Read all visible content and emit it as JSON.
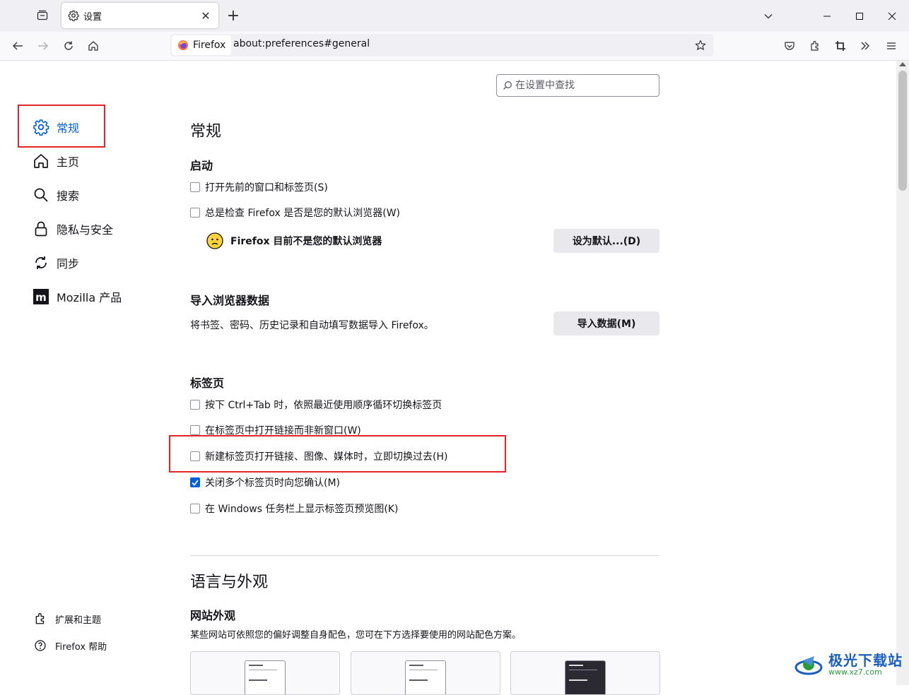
{
  "browser": {
    "tab_title": "设置",
    "url_identity": "Firefox",
    "url": "about:preferences#general"
  },
  "search": {
    "placeholder": "在设置中查找"
  },
  "sidebar": {
    "items": [
      {
        "label": "常规",
        "icon": "gear-icon"
      },
      {
        "label": "主页",
        "icon": "home-icon"
      },
      {
        "label": "搜索",
        "icon": "search-icon"
      },
      {
        "label": "隐私与安全",
        "icon": "lock-icon"
      },
      {
        "label": "同步",
        "icon": "sync-icon"
      },
      {
        "label": "Mozilla 产品",
        "icon": "mozilla-icon"
      }
    ],
    "footer": [
      {
        "label": "扩展和主题",
        "icon": "puzzle-icon"
      },
      {
        "label": "Firefox 帮助",
        "icon": "help-icon"
      }
    ]
  },
  "main": {
    "title": "常规",
    "startup": {
      "heading": "启动",
      "options": [
        {
          "label": "打开先前的窗口和标签页(S)",
          "checked": false
        },
        {
          "label": "总是检查 Firefox 是否是您的默认浏览器(W)",
          "checked": false
        }
      ],
      "default_notice": "Firefox 目前不是您的默认浏览器",
      "default_button": "设为默认...(D)"
    },
    "import": {
      "heading": "导入浏览器数据",
      "desc": "将书签、密码、历史记录和自动填写数据导入 Firefox。",
      "button": "导入数据(M)"
    },
    "tabs": {
      "heading": "标签页",
      "options": [
        {
          "label": "按下 Ctrl+Tab 时，依照最近使用顺序循环切换标签页",
          "checked": false
        },
        {
          "label": "在标签页中打开链接而非新窗口(W)",
          "checked": false
        },
        {
          "label": "新建标签页打开链接、图像、媒体时，立即切换过去(H)",
          "checked": false
        },
        {
          "label": "关闭多个标签页时向您确认(M)",
          "checked": true
        },
        {
          "label": "在 Windows 任务栏上显示标签页预览图(K)",
          "checked": false
        }
      ]
    },
    "language": {
      "title": "语言与外观",
      "site_heading": "网站外观",
      "site_desc": "某些网站可依照您的偏好调整自身配色，您可在下方选择要使用的网站配色方案。"
    }
  },
  "watermark": {
    "line1": "极光下载站",
    "line2": "www.xz7.com"
  },
  "colors": {
    "accent": "#0061e0",
    "highlight_box": "#e5242a"
  }
}
